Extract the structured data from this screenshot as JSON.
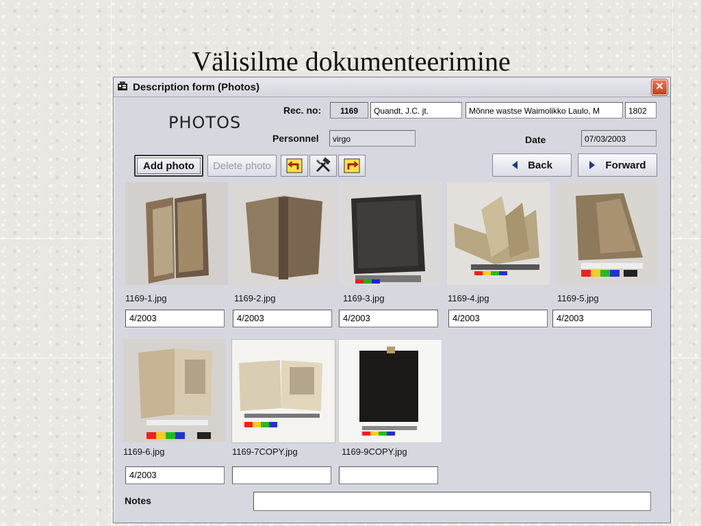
{
  "slide": {
    "title": "Välisilme dokumenteerimine"
  },
  "window": {
    "title": "Description form (Photos)",
    "close_glyph": "✕"
  },
  "form": {
    "heading": "PHOTOS",
    "rec_no_label": "Rec. no:",
    "rec_no_value": "1169",
    "author_value": "Quandt, J.C. jt.",
    "book_title_value": "Mõnne wastse Waimolikko Laulo, M",
    "year_value": "1802",
    "personnel_label": "Personnel",
    "personnel_value": "virgo",
    "date_label": "Date",
    "date_value": "07/03/2003"
  },
  "toolbar": {
    "add_photo_label": "Add photo",
    "delete_photo_label": "Delete photo",
    "back_label": "Back",
    "forward_label": "Forward",
    "icons": [
      "undo-icon",
      "tools-icon",
      "redo-icon"
    ]
  },
  "photos": [
    {
      "filename": "1169-1.jpg",
      "date": "4/2003"
    },
    {
      "filename": "1169-2.jpg",
      "date": "4/2003"
    },
    {
      "filename": "1169-3.jpg",
      "date": "4/2003"
    },
    {
      "filename": "1169-4.jpg",
      "date": "4/2003"
    },
    {
      "filename": "1169-5.jpg",
      "date": "4/2003"
    },
    {
      "filename": "1169-6.jpg",
      "date": "4/2003"
    },
    {
      "filename": "1169-7COPY.jpg",
      "date": ""
    },
    {
      "filename": "1169-9COPY.jpg",
      "date": ""
    }
  ],
  "notes": {
    "label": "Notes",
    "value": ""
  },
  "colors": {
    "accent": "#1a3a8a",
    "close": "#d9482a",
    "window_bg": "#d7d7e0"
  }
}
